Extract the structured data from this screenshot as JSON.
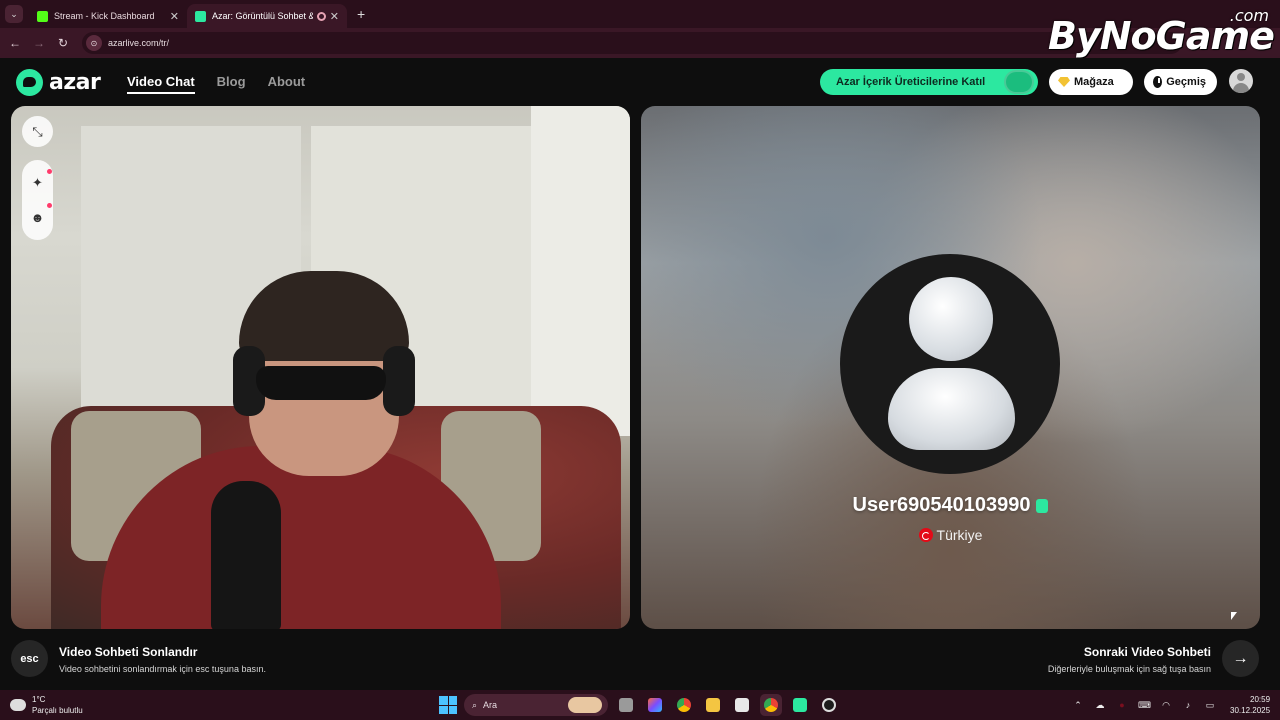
{
  "browser": {
    "tabs": [
      {
        "title": "Stream - Kick Dashboard",
        "active": false
      },
      {
        "title": "Azar: Görüntülü Sohbet & V",
        "active": true
      }
    ],
    "url": "azarlive.com/tr/"
  },
  "watermark": {
    "text": "ByNoGame",
    "suffix": ".com"
  },
  "header": {
    "logo": "azar",
    "nav": [
      "Video Chat",
      "Blog",
      "About"
    ],
    "creators_label": "Azar İçerik Üreticilerine Katıl",
    "store_label": "Mağaza",
    "history_label": "Geçmiş"
  },
  "partner": {
    "username": "User690540103990",
    "country": "Türkiye"
  },
  "footer": {
    "esc_key": "esc",
    "end_title": "Video Sohbeti Sonlandır",
    "end_sub": "Video sohbetini sonlandırmak için esc tuşuna basın.",
    "next_title": "Sonraki Video Sohbeti",
    "next_sub": "Diğerleriyle buluşmak için sağ tuşa basın"
  },
  "taskbar": {
    "temperature": "1°C",
    "weather": "Parçalı bulutlu",
    "search_placeholder": "Ara",
    "time": "20:59",
    "date": "30.12.2025"
  },
  "colors": {
    "accent": "#2ce8a0",
    "browser_frame": "#2a0f1b",
    "app_bg": "#0e0e0e"
  }
}
